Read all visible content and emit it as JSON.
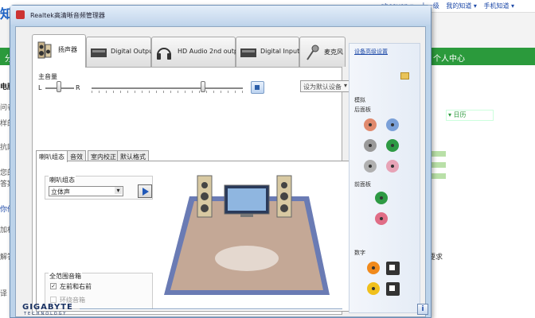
{
  "background_page": {
    "logo_text": "知",
    "user_links": [
      "gheaven ▾",
      "十一级",
      "我的知道 ▾",
      "手机知道 ▾"
    ],
    "nav_left": "分",
    "nav_right": "个人中心",
    "left_fragments": [
      "电脑",
      "问者",
      "样的",
      "抗网",
      "您的",
      "答案",
      "你他",
      "加相",
      "解答",
      "译"
    ],
    "right_tab": "▾ 日历",
    "right_text": "要求"
  },
  "window": {
    "title": "Realtek高清晰音频管理器"
  },
  "device_tabs": [
    {
      "label": "扬声器",
      "active": true
    },
    {
      "label": "Digital Output",
      "active": false
    },
    {
      "label": "HD Audio 2nd output",
      "active": false
    },
    {
      "label": "Digital Input",
      "active": false
    },
    {
      "label": "麦克风",
      "active": false
    }
  ],
  "volume": {
    "title": "主音量",
    "left_label": "L",
    "right_label": "R",
    "balance_position": 0.45,
    "level_percent": 72,
    "default_device": "设为默认设备"
  },
  "inner_tabs": [
    {
      "label": "喇叭组态",
      "active": true
    },
    {
      "label": "音效",
      "active": false
    },
    {
      "label": "室内校正",
      "active": false
    },
    {
      "label": "默认格式",
      "active": false
    }
  ],
  "speaker_config": {
    "label": "喇叭组态",
    "selected": "立体声"
  },
  "full_range": {
    "title": "全范围音箱",
    "options": [
      {
        "label": "左前和右前",
        "checked": true,
        "enabled": true
      },
      {
        "label": "环绕音箱",
        "checked": false,
        "enabled": false
      }
    ]
  },
  "side_panel": {
    "advanced_link": "设备高级设置",
    "analog_label": "模拟",
    "rear_label": "后面板",
    "front_label": "前面板",
    "digital_label": "数字",
    "rear_jacks": [
      "#e08a6e",
      "#7aa0d8",
      "#9a9a9a",
      "#2e9a44",
      "#b0b0b0",
      "#e7a3b6"
    ],
    "front_jacks": [
      "#2e9a44",
      "#e06d86"
    ],
    "digital_jacks": [
      "#f08a1c",
      "#f0c01c"
    ]
  },
  "brand": {
    "logo": "GIGABYTE",
    "sub": "TECHNOLOGY",
    "info_label": "i"
  }
}
